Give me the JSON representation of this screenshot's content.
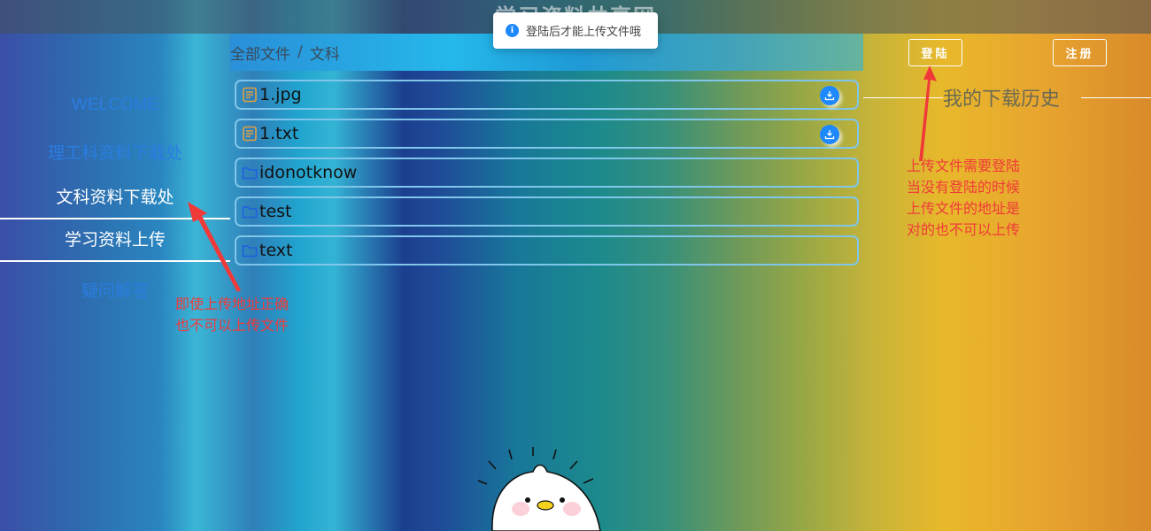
{
  "header": {
    "title": "学习资料共享网"
  },
  "toast": {
    "icon": "info-icon",
    "message": "登陆后才能上传文件哦",
    "color": "#1e88ff"
  },
  "breadcrumb": {
    "root": "全部文件",
    "separator": "/",
    "current": "文科"
  },
  "auth": {
    "login_label": "登陆",
    "register_label": "注册"
  },
  "sidebar": {
    "items": [
      {
        "label": "WELCOME"
      },
      {
        "label": "理工科资料下载处"
      },
      {
        "label": "文科资料下载处"
      },
      {
        "label": "学习资料上传"
      },
      {
        "label": "疑问解答"
      }
    ]
  },
  "files": [
    {
      "name": "1.jpg",
      "icon": "document-icon",
      "downloadable": true
    },
    {
      "name": "1.txt",
      "icon": "document-icon",
      "downloadable": true
    },
    {
      "name": "idonotknow",
      "icon": "folder-icon",
      "downloadable": false
    },
    {
      "name": "test",
      "icon": "folder-icon",
      "downloadable": false
    },
    {
      "name": "text",
      "icon": "folder-icon",
      "downloadable": false
    }
  ],
  "history": {
    "title": "我的下载历史"
  },
  "annotations": {
    "right": [
      "上传文件需要登陆",
      "当没有登陆的时候",
      "上传文件的地址是",
      "对的也不可以上传"
    ],
    "left": [
      "即使上传地址正确",
      "也不可以上传文件"
    ]
  },
  "colors": {
    "accent": "#1e88ff",
    "annotation": "#f03a3a",
    "nav_blue": "#2a7de0"
  }
}
